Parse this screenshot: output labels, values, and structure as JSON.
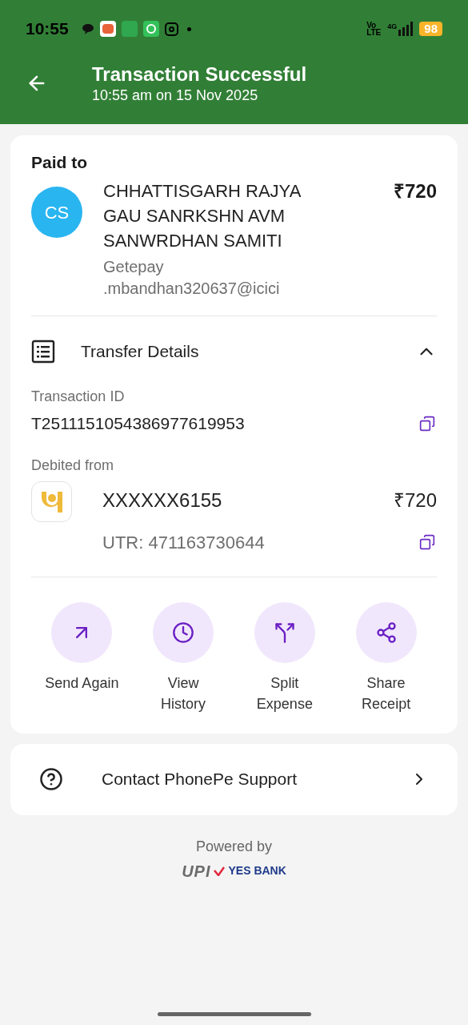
{
  "status_bar": {
    "time": "10:55",
    "network_top": "Vo",
    "network_bottom": "LTE",
    "data_type": "4G",
    "battery": "98"
  },
  "header": {
    "title": "Transaction Successful",
    "subtitle": "10:55 am on 15 Nov 2025"
  },
  "payee": {
    "label": "Paid to",
    "initials": "CS",
    "name": "CHHATTISGARH RAJYA GAU SANRKSHN AVM SANWRDHAN SAMITI",
    "amount": "₹720",
    "vpa_lines": [
      "Getepay",
      ".mbandhan320637@icici"
    ]
  },
  "transfer_details": {
    "title": "Transfer Details",
    "expanded": true,
    "transaction_id_label": "Transaction ID",
    "transaction_id": "T2511151054386977619953",
    "debited_label": "Debited from",
    "account": "XXXXXX6155",
    "amount": "₹720",
    "utr": "UTR: 471163730644"
  },
  "actions": [
    {
      "kind": "send",
      "label": "Send Again"
    },
    {
      "kind": "history",
      "label": "View History"
    },
    {
      "kind": "split",
      "label": "Split Expense"
    },
    {
      "kind": "share",
      "label": "Share Receipt"
    }
  ],
  "support": {
    "label": "Contact PhonePe Support"
  },
  "footer": {
    "powered_by": "Powered by",
    "upi": "UPI",
    "bank": "YES BANK"
  }
}
